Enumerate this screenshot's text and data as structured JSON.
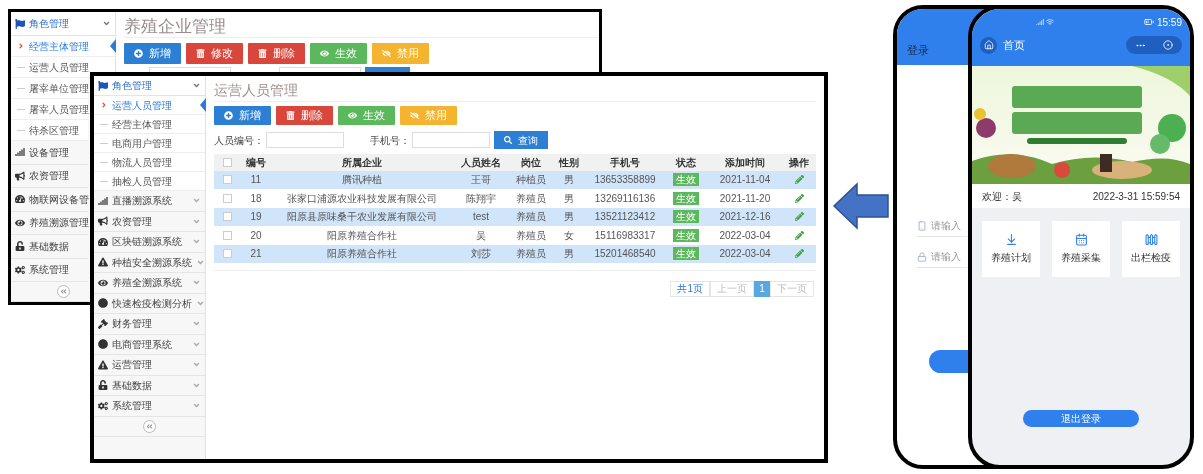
{
  "back_window": {
    "sidebar": {
      "items": [
        {
          "label": "角色管理",
          "expanded": true,
          "children": [
            {
              "label": "经营主体管理",
              "selected": true
            },
            {
              "label": "运营人员管理",
              "selected": false
            },
            {
              "label": "屠宰单位管理",
              "selected": false
            },
            {
              "label": "屠宰人员管理",
              "selected": false
            },
            {
              "label": "待杀区管理",
              "selected": false
            }
          ]
        },
        {
          "label": "设备管理"
        },
        {
          "label": "农资管理"
        },
        {
          "label": "物联网设备管"
        },
        {
          "label": "养殖溯源管理"
        },
        {
          "label": "基础数据"
        },
        {
          "label": "系统管理"
        }
      ]
    },
    "title": "养殖企业管理",
    "buttons": [
      {
        "label": "新增",
        "kind": "add"
      },
      {
        "label": "修改",
        "kind": "edit"
      },
      {
        "label": "删除",
        "kind": "delete"
      },
      {
        "label": "生效",
        "kind": "enable"
      },
      {
        "label": "禁用",
        "kind": "disable"
      }
    ]
  },
  "front_window": {
    "sidebar": {
      "items": [
        {
          "label": "角色管理",
          "expanded": true,
          "children": [
            {
              "label": "运营人员管理",
              "selected": true
            },
            {
              "label": "经营主体管理",
              "selected": false
            },
            {
              "label": "电商用户管理",
              "selected": false
            },
            {
              "label": "物流人员管理",
              "selected": false
            },
            {
              "label": "抽检人员管理",
              "selected": false
            }
          ]
        },
        {
          "label": "直播溯源系统",
          "expanded": false
        },
        {
          "label": "农资管理",
          "expanded": false
        },
        {
          "label": "区块链溯源系统",
          "expanded": false
        },
        {
          "label": "种植安全溯源系统",
          "expanded": false
        },
        {
          "label": "养殖全溯源系统",
          "expanded": false
        },
        {
          "label": "快速检疫检测分析",
          "expanded": false
        },
        {
          "label": "财务管理",
          "expanded": false
        },
        {
          "label": "电商管理系统",
          "expanded": false
        },
        {
          "label": "运营管理",
          "expanded": false
        },
        {
          "label": "基础数据",
          "expanded": false
        },
        {
          "label": "系统管理",
          "expanded": false
        }
      ]
    },
    "title": "运营人员管理",
    "buttons": [
      {
        "label": "新增",
        "kind": "add"
      },
      {
        "label": "删除",
        "kind": "delete"
      },
      {
        "label": "生效",
        "kind": "enable"
      },
      {
        "label": "禁用",
        "kind": "disable"
      }
    ],
    "filters": [
      {
        "label": "人员编号："
      },
      {
        "label": "手机号："
      }
    ],
    "search_button": "查询",
    "table": {
      "columns": [
        "编号",
        "所属企业",
        "人员姓名",
        "岗位",
        "性别",
        "手机号",
        "状态",
        "添加时间",
        "操作"
      ],
      "header_checked": false,
      "rows": [
        {
          "checked": false,
          "cells": [
            "11",
            "腾讯种植",
            "王哥",
            "种植员",
            "男",
            "13653358899",
            "生效",
            "2021-11-04"
          ]
        },
        {
          "checked": false,
          "cells": [
            "18",
            "张家口浦源农业科技发展有限公司",
            "陈翔宇",
            "养殖员",
            "男",
            "13269116136",
            "生效",
            "2021-11-20"
          ]
        },
        {
          "checked": false,
          "cells": [
            "19",
            "阳原县原味桑干农业发展有限公司",
            "test",
            "养殖员",
            "男",
            "13521123412",
            "生效",
            "2021-12-16"
          ]
        },
        {
          "checked": false,
          "cells": [
            "20",
            "阳原养殖合作社",
            "吴",
            "养殖员",
            "女",
            "15116983317",
            "生效",
            "2022-03-04"
          ]
        },
        {
          "checked": false,
          "cells": [
            "21",
            "阳原养殖合作社",
            "刘莎",
            "养殖员",
            "男",
            "15201468540",
            "生效",
            "2022-03-04"
          ]
        }
      ]
    },
    "pagination": {
      "total": "共1页",
      "prev": {
        "label": "上一页",
        "disabled": true
      },
      "pages": [
        {
          "label": "1",
          "selected": true
        }
      ],
      "next": {
        "label": "下一页",
        "disabled": true
      }
    }
  },
  "login_phone": {
    "title": "登录",
    "fields": [
      {
        "placeholder": "请输入",
        "kind": "phone"
      },
      {
        "placeholder": "请输入",
        "kind": "password"
      }
    ]
  },
  "home_phone": {
    "clock": "15:59",
    "title": "首页",
    "welcome": "欢迎：吴",
    "datetime": "2022-3-31 15:59:54",
    "tiles": [
      {
        "label": "养殖计划"
      },
      {
        "label": "养殖采集"
      },
      {
        "label": "出栏检疫"
      }
    ],
    "logout": "退出登录"
  }
}
